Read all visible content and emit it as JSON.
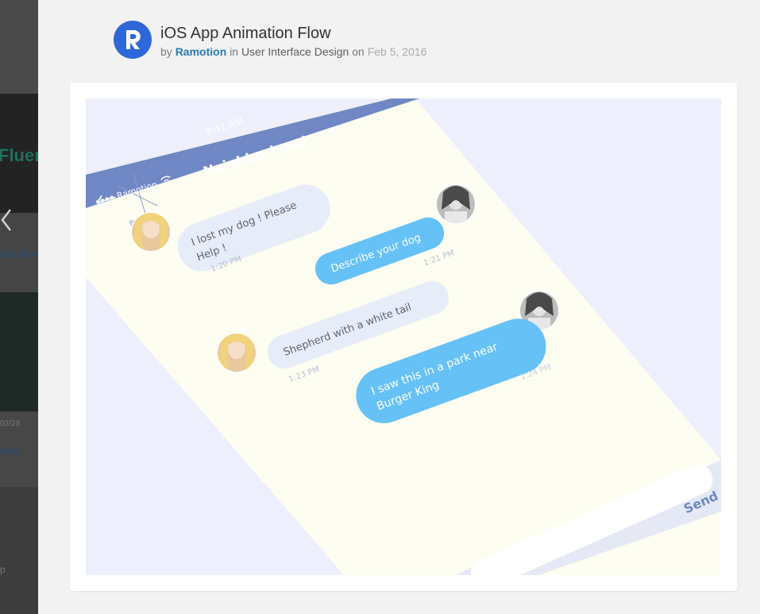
{
  "background": {
    "fragments": {
      "fluent": "Fluen",
      "den": "den Pavl",
      "date": "03/29",
      "rso": "RSO",
      "p": "p"
    }
  },
  "post": {
    "title": "iOS App Animation Flow",
    "by_label": "by",
    "author": "Ramotion",
    "in_label": "in",
    "category": "User Interface Design",
    "on_label": "on",
    "date": "Feb 5, 2016"
  },
  "phone": {
    "time": "9:41 AM",
    "carrier": "Ramotion",
    "screen_title": "Neighborhood",
    "map_label": "Buenavi",
    "send_label": "Send",
    "messages": [
      {
        "side": "left",
        "line1": "I lost my dog ! Please",
        "line2": "Help !",
        "time": "1:20 PM"
      },
      {
        "side": "right",
        "line1": "Describe your dog",
        "line2": "",
        "time": "1:21 PM"
      },
      {
        "side": "left",
        "line1": "Shepherd  with a white tail",
        "line2": "",
        "time": "1:23 PM"
      },
      {
        "side": "right",
        "line1": "I saw this in a park near",
        "line2": "Burger King",
        "time": "1:24 PM"
      }
    ]
  },
  "colors": {
    "accent": "#2d67d8",
    "author_link": "#2a7ab5",
    "nav_bar": "#6f87c4",
    "outgoing_bubble": "#66c1f7",
    "incoming_bubble": "#e6ecf8",
    "screen_bg": "#fdfdf1"
  },
  "icons": [
    "logo-r-icon",
    "chevron-left-icon",
    "back-arrow-icon",
    "wifi-icon"
  ]
}
